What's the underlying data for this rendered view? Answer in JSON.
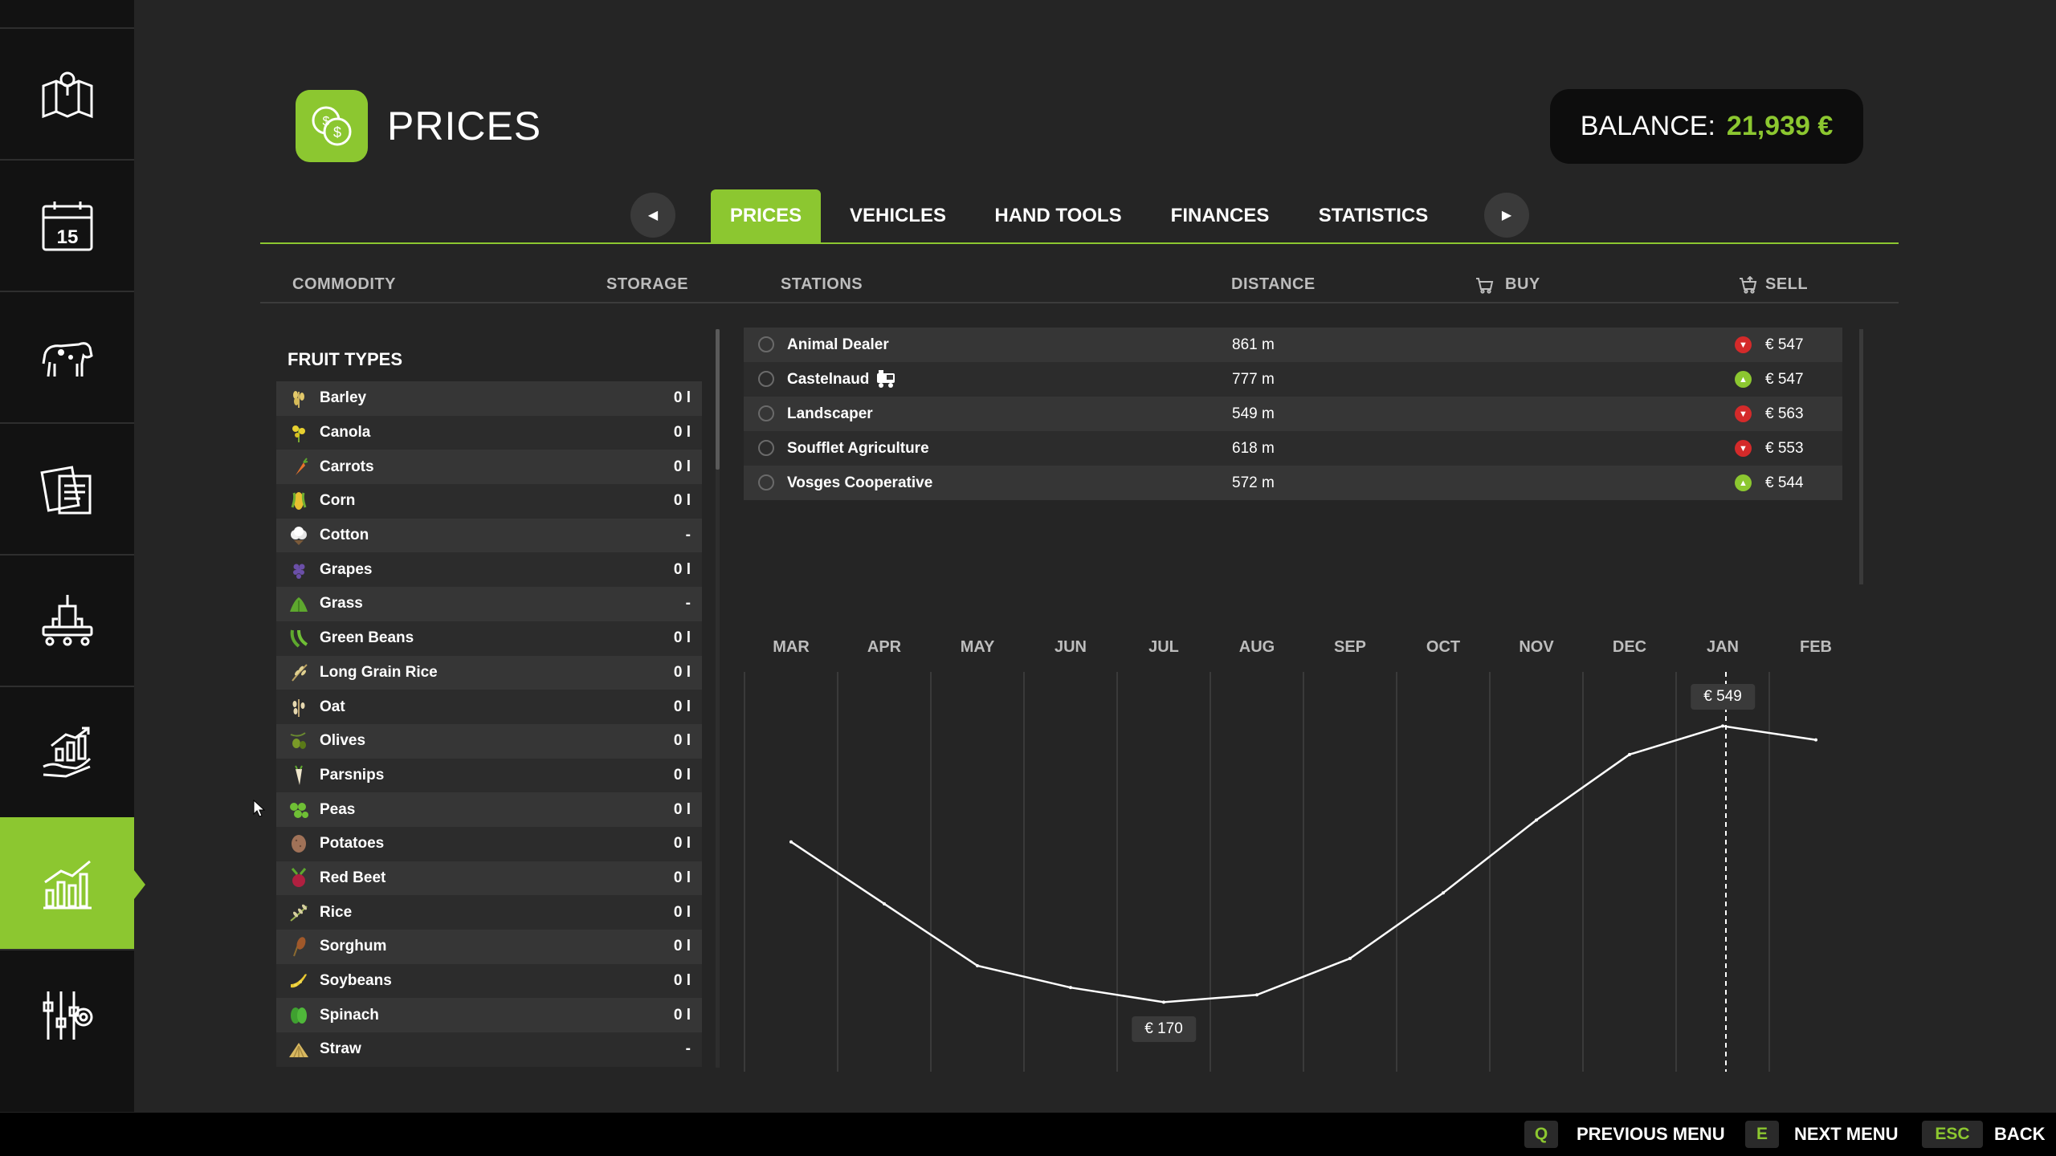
{
  "header": {
    "title": "PRICES",
    "balance_label": "BALANCE:",
    "balance_value": "21,939 €"
  },
  "sidebar": {
    "items": [
      {
        "icon": "map-icon"
      },
      {
        "icon": "calendar-icon",
        "label": "15"
      },
      {
        "icon": "cow-icon"
      },
      {
        "icon": "contracts-icon"
      },
      {
        "icon": "production-icon"
      },
      {
        "icon": "economy-icon"
      },
      {
        "icon": "prices-chart-icon",
        "active": true
      },
      {
        "icon": "settings-icon"
      }
    ]
  },
  "tabs": [
    "PRICES",
    "VEHICLES",
    "HAND TOOLS",
    "FINANCES",
    "STATISTICS"
  ],
  "active_tab": "PRICES",
  "columns": {
    "commodity": "COMMODITY",
    "storage": "STORAGE",
    "stations": "STATIONS",
    "distance": "DISTANCE",
    "buy": "BUY",
    "sell": "SELL"
  },
  "commodities": {
    "group_label": "FRUIT TYPES",
    "items": [
      {
        "name": "Barley",
        "storage": "0 l",
        "icon": "barley-icon"
      },
      {
        "name": "Canola",
        "storage": "0 l",
        "icon": "canola-icon"
      },
      {
        "name": "Carrots",
        "storage": "0 l",
        "icon": "carrot-icon"
      },
      {
        "name": "Corn",
        "storage": "0 l",
        "icon": "corn-icon"
      },
      {
        "name": "Cotton",
        "storage": "-",
        "icon": "cotton-icon"
      },
      {
        "name": "Grapes",
        "storage": "0 l",
        "icon": "grapes-icon"
      },
      {
        "name": "Grass",
        "storage": "-",
        "icon": "grass-icon"
      },
      {
        "name": "Green Beans",
        "storage": "0 l",
        "icon": "green-beans-icon"
      },
      {
        "name": "Long Grain Rice",
        "storage": "0 l",
        "icon": "long-grain-rice-icon"
      },
      {
        "name": "Oat",
        "storage": "0 l",
        "icon": "oat-icon"
      },
      {
        "name": "Olives",
        "storage": "0 l",
        "icon": "olives-icon"
      },
      {
        "name": "Parsnips",
        "storage": "0 l",
        "icon": "parsnip-icon"
      },
      {
        "name": "Peas",
        "storage": "0 l",
        "icon": "peas-icon"
      },
      {
        "name": "Potatoes",
        "storage": "0 l",
        "icon": "potato-icon"
      },
      {
        "name": "Red Beet",
        "storage": "0 l",
        "icon": "red-beet-icon"
      },
      {
        "name": "Rice",
        "storage": "0 l",
        "icon": "rice-icon"
      },
      {
        "name": "Sorghum",
        "storage": "0 l",
        "icon": "sorghum-icon"
      },
      {
        "name": "Soybeans",
        "storage": "0 l",
        "icon": "soybeans-icon"
      },
      {
        "name": "Spinach",
        "storage": "0 l",
        "icon": "spinach-icon"
      },
      {
        "name": "Straw",
        "storage": "-",
        "icon": "straw-icon"
      }
    ]
  },
  "stations": [
    {
      "name": "Animal Dealer",
      "distance": "861 m",
      "trend": "down",
      "price": "€ 547"
    },
    {
      "name": "Castelnaud",
      "distance": "777 m",
      "trend": "up",
      "price": "€ 547",
      "train": true
    },
    {
      "name": "Landscaper",
      "distance": "549 m",
      "trend": "down",
      "price": "€ 563"
    },
    {
      "name": "Soufflet Agriculture",
      "distance": "618 m",
      "trend": "down",
      "price": "€ 553"
    },
    {
      "name": "Vosges Cooperative",
      "distance": "572 m",
      "trend": "up",
      "price": "€ 544"
    }
  ],
  "colors": {
    "accent": "#8cc730",
    "trend_down": "#d42a2a",
    "trend_up": "#8cc730"
  },
  "chart_data": {
    "type": "line",
    "categories": [
      "MAR",
      "APR",
      "MAY",
      "JUN",
      "JUL",
      "AUG",
      "SEP",
      "OCT",
      "NOV",
      "DEC",
      "JAN",
      "FEB"
    ],
    "values": [
      390,
      305,
      220,
      190,
      170,
      180,
      230,
      320,
      420,
      510,
      549,
      530
    ],
    "min_label": "€ 170",
    "max_label": "€ 549",
    "ylim": [
      80,
      620
    ],
    "grid": "vertical",
    "marker_at": "JAN"
  },
  "footer": {
    "prev_key": "Q",
    "prev_label": "PREVIOUS MENU",
    "next_key": "E",
    "next_label": "NEXT MENU",
    "back_key": "ESC",
    "back_label": "BACK"
  }
}
